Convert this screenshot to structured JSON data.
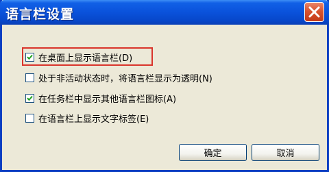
{
  "window": {
    "title": "语言栏设置"
  },
  "options": [
    {
      "label": "在桌面上显示语言栏(D)",
      "checked": true
    },
    {
      "label": "处于非活动状态时，将语言栏显示为透明(N)",
      "checked": false
    },
    {
      "label": "在任务栏中显示其他语言栏图标(A)",
      "checked": true
    },
    {
      "label": "在语言栏上显示文字标签(E)",
      "checked": false
    }
  ],
  "buttons": {
    "ok": "确定",
    "cancel": "取消"
  },
  "colors": {
    "titlebar": "#0a52db",
    "close": "#d8532f",
    "highlight": "#d9342b",
    "face": "#ece9d8"
  },
  "icons": {
    "close": "close-icon",
    "check": "checkmark-icon"
  }
}
